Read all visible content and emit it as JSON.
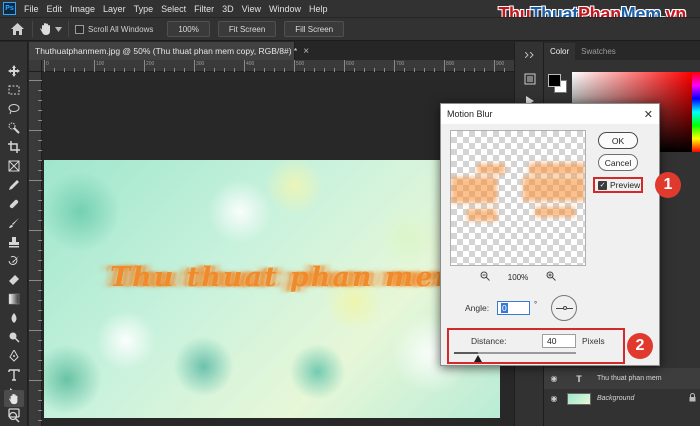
{
  "app": {
    "logo": "Ps",
    "menu": [
      "File",
      "Edit",
      "Image",
      "Layer",
      "Type",
      "Select",
      "Filter",
      "3D",
      "View",
      "Window",
      "Help"
    ]
  },
  "watermark": {
    "part1": "Thu",
    "part2": "Thuat",
    "part3": "Phan",
    "part4": "Mem",
    "part5": ".vn"
  },
  "options_bar": {
    "scroll_all_label": "Scroll All Windows",
    "zoom_value": "100%",
    "fit_screen_label": "Fit Screen",
    "fill_screen_label": "Fill Screen"
  },
  "document": {
    "tab_title": "Thuthuatphanmem.jpg @ 50% (Thu thuat phan mem copy, RGB/8#) *",
    "close_glyph": "×",
    "canvas_text": "Thu thuat phan mem"
  },
  "ruler": {
    "h_labels": [
      "0",
      "100",
      "200",
      "300",
      "400",
      "500",
      "600",
      "700",
      "800",
      "900"
    ]
  },
  "color_panel": {
    "tabs": [
      "Color",
      "Swatches"
    ]
  },
  "layers": [
    {
      "name": "Thu thuat phan mem",
      "thumb": "T",
      "kind": "text"
    },
    {
      "name": "Background",
      "kind": "image",
      "locked": true
    }
  ],
  "dialog": {
    "title": "Motion Blur",
    "close_glyph": "✕",
    "ok_label": "OK",
    "cancel_label": "Cancel",
    "preview_label": "Preview",
    "preview_checked": true,
    "zoom_level": "100%",
    "angle_label": "Angle:",
    "angle_value": "0",
    "degree_symbol": "°",
    "distance_label": "Distance:",
    "distance_value": "40",
    "distance_unit": "Pixels",
    "distance_slider_fraction": 0.2
  },
  "callouts": [
    "1",
    "2"
  ],
  "colors": {
    "callout": "#e03a2f",
    "highlight_border": "#d22a2a",
    "canvas_text": "#f08a2a",
    "watermark_red": "#c8151d",
    "watermark_blue": "#1b5fa8"
  }
}
